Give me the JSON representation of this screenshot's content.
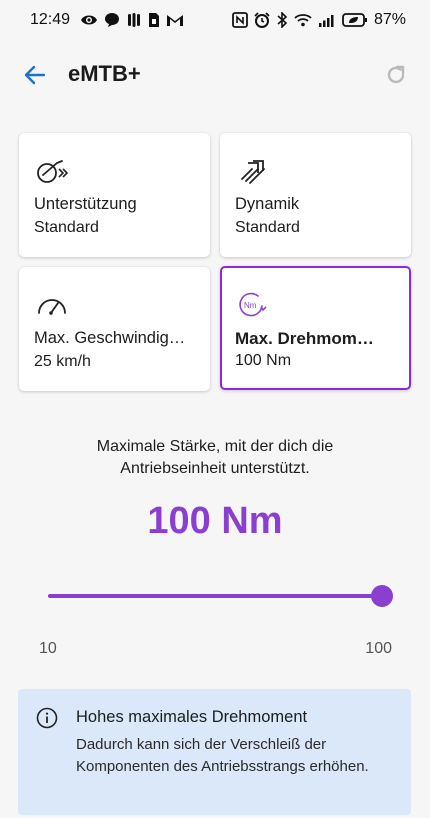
{
  "status_bar": {
    "time": "12:49",
    "battery": "87%"
  },
  "app_bar": {
    "title": "eMTB+",
    "back_icon": "arrow-back-icon",
    "refresh_icon": "refresh-icon"
  },
  "cards": [
    {
      "label": "Unterstützung",
      "value": "Standard",
      "icon": "assist-icon",
      "selected": false
    },
    {
      "label": "Dynamik",
      "value": "Standard",
      "icon": "dynamics-icon",
      "selected": false
    },
    {
      "label": "Max. Geschwindig…",
      "value": "25 km/h",
      "icon": "speedometer-icon",
      "selected": false
    },
    {
      "label": "Max. Drehmom…",
      "value": "100 Nm",
      "icon": "torque-icon",
      "selected": true
    }
  ],
  "detail": {
    "description": "Maximale Stärke, mit der dich die Antriebseinheit unterstützt.",
    "value": "100 Nm"
  },
  "slider": {
    "min_label": "10",
    "max_label": "100",
    "min": 10,
    "max": 100,
    "value": 100
  },
  "info_box": {
    "title": "Hohes maximales Drehmoment",
    "text": "Dadurch kann sich der Verschleiß der Komponenten des Antriebsstrangs erhöhen.",
    "icon": "info-icon"
  },
  "colors": {
    "accent": "#8a3fd1",
    "selected_border": "#8a2be2",
    "info_bg": "#dbe8f9",
    "back_arrow": "#1a73c9"
  }
}
